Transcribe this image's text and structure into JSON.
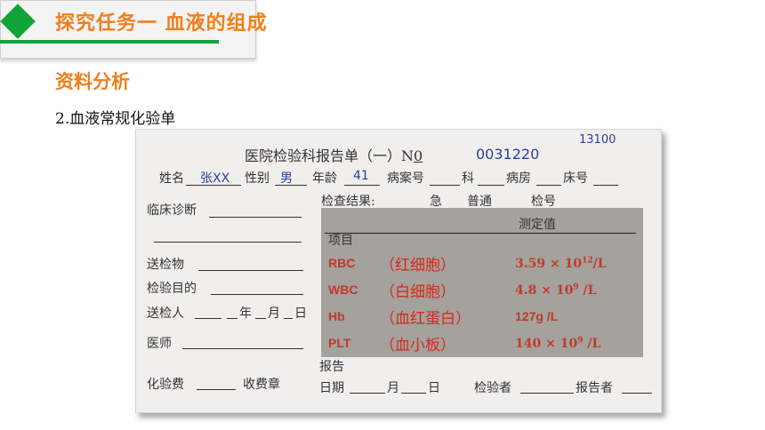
{
  "header": {
    "title": "探究任务一  血液的组成"
  },
  "section": {
    "label": "资料分析"
  },
  "subtitle": "2.血液常规化验单",
  "report": {
    "code": "13100",
    "title": "医院检验科报告单（一）N",
    "no_mark": "0",
    "number": "0031220",
    "name_label": "姓名",
    "name_value": "张XX",
    "gender_label": "性别",
    "gender_value": "男",
    "age_label": "年龄",
    "age_value": "41",
    "case_label": "病案号",
    "dept_label": "科",
    "ward_label": "病房",
    "bed_label": "床号",
    "diagnosis_label": "临床诊断",
    "specimen_label": "送检物",
    "purpose_label": "检验目的",
    "sender_label": "送检人",
    "date_y": "年",
    "date_m": "月",
    "date_d": "日",
    "doctor_label": "医师",
    "fee_label": "化验费",
    "fee_seal_label": "收费章",
    "result_label": "检查结果:",
    "urgent": "急",
    "normal": "普通",
    "test_no": "检号",
    "measured": "测定值",
    "item": "项目",
    "rows": [
      {
        "abbr": "RBC",
        "name": "（红细胞）",
        "value": "3.59 × 10",
        "exp": "12",
        "unit": "/L"
      },
      {
        "abbr": "WBC",
        "name": "（白细胞）",
        "value": "4.8  × 10",
        "exp": "9",
        "unit": " /L"
      },
      {
        "abbr": "Hb",
        "name": "（血红蛋白）",
        "value": "127g /L",
        "exp": "",
        "unit": ""
      },
      {
        "abbr": "PLT",
        "name": "（血小板）",
        "value": "140  × 10",
        "exp": "9",
        "unit": " /L"
      }
    ],
    "report_label": "报告",
    "date_label": "日期",
    "month": "月",
    "day": "日",
    "inspector_label": "检验者",
    "reporter_label": "报告者"
  }
}
